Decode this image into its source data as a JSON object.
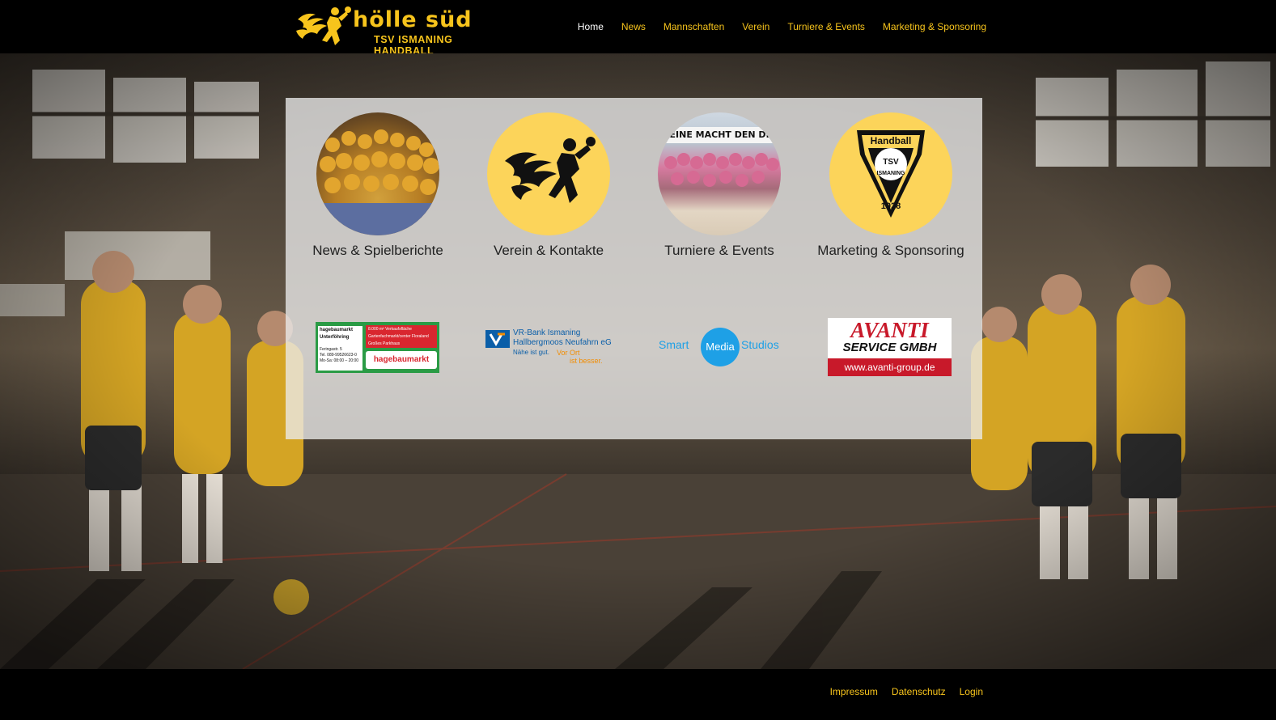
{
  "brand": {
    "title": "hölle süd",
    "subtitle": "TSV ISMANING HANDBALL",
    "accent": "#f7c41c"
  },
  "nav": {
    "items": [
      {
        "label": "Home",
        "active": true
      },
      {
        "label": "News"
      },
      {
        "label": "Mannschaften"
      },
      {
        "label": "Verein"
      },
      {
        "label": "Turniere & Events"
      },
      {
        "label": "Marketing & Sponsoring"
      }
    ]
  },
  "tiles": [
    {
      "label": "News & Spielberichte"
    },
    {
      "label": "Verein & Kontakte"
    },
    {
      "label": "Turniere & Events",
      "banner": "KEINE MACHT DEN DROGEN"
    },
    {
      "label": "Marketing & Sponsoring",
      "badge_top": "Handball",
      "badge_mid": "TSV",
      "badge_bottom": "ISMANING",
      "badge_year": "1928"
    }
  ],
  "sponsors": {
    "hagebau": {
      "name_line1": "hagebaumarkt",
      "name_line2": "Unterföhring",
      "feature1": "8.000 m² Verkaufsfläche",
      "feature2": "Gartenfachmarkt/center Floraland",
      "feature3": "Großes Parkhaus",
      "address": "Feringastr. 5",
      "phone": "Tel. 089-99526623-0",
      "hours": "Mo-Sa: 08:00 – 20:00",
      "logo": "hagebaumarkt"
    },
    "vr": {
      "line1": "VR-Bank Ismaning",
      "line2": "Hallbergmoos Neufahrn eG",
      "slogan_a": "Nähe ist gut.",
      "slogan_b": "Vor Ort",
      "slogan_c": "ist besser."
    },
    "smart": {
      "left": "Smart",
      "mid": "Media",
      "right": "Studios"
    },
    "avanti": {
      "name": "AVANTI",
      "line2": "SERVICE GMBH",
      "url": "www.avanti-group.de"
    }
  },
  "footer": {
    "links": [
      "Impressum",
      "Datenschutz",
      "Login"
    ]
  },
  "colors": {
    "accent": "#f7c41c",
    "header_bg": "#000000",
    "avanti_red": "#c8192a",
    "hagebau_green": "#2a9b45",
    "vr_blue": "#0a5ea8",
    "vr_orange": "#f28c00",
    "smart_blue": "#1ea0e6"
  }
}
